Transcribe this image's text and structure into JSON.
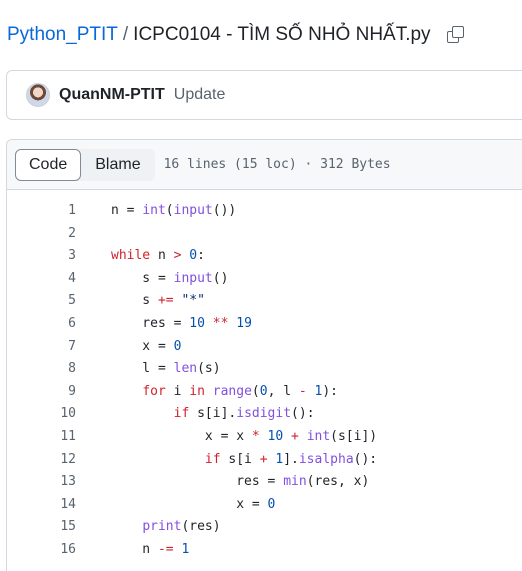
{
  "breadcrumb": {
    "repo": "Python_PTIT",
    "separator": "/",
    "file": "ICPC0104 - TÌM SỐ NHỎ NHẤT.py",
    "copy_icon": "copy-icon"
  },
  "commit": {
    "author": "QuanNM-PTIT",
    "message": "Update"
  },
  "file_header": {
    "code_tab": "Code",
    "blame_tab": "Blame",
    "meta": "16 lines (15 loc) · 312 Bytes"
  },
  "colors": {
    "link": "#0969da",
    "keyword": "#cf222e",
    "function": "#8250df",
    "number": "#0550ae",
    "string": "#0a3069"
  },
  "code": {
    "lines": [
      {
        "num": "1",
        "tokens": [
          [
            "",
            "n = "
          ],
          [
            "f",
            "int"
          ],
          [
            "",
            "("
          ],
          [
            "f",
            "input"
          ],
          [
            "",
            "())"
          ]
        ]
      },
      {
        "num": "2",
        "tokens": []
      },
      {
        "num": "3",
        "tokens": [
          [
            "k",
            "while"
          ],
          [
            "",
            " n "
          ],
          [
            "k",
            ">"
          ],
          [
            "",
            " "
          ],
          [
            "n",
            "0"
          ],
          [
            "",
            ":"
          ]
        ]
      },
      {
        "num": "4",
        "tokens": [
          [
            "",
            "    s = "
          ],
          [
            "f",
            "input"
          ],
          [
            "",
            "()"
          ]
        ]
      },
      {
        "num": "5",
        "tokens": [
          [
            "",
            "    s "
          ],
          [
            "k",
            "+="
          ],
          [
            "",
            " "
          ],
          [
            "s",
            "\"*\""
          ]
        ]
      },
      {
        "num": "6",
        "tokens": [
          [
            "",
            "    res = "
          ],
          [
            "n",
            "10"
          ],
          [
            "",
            " "
          ],
          [
            "k",
            "**"
          ],
          [
            "",
            " "
          ],
          [
            "n",
            "19"
          ]
        ]
      },
      {
        "num": "7",
        "tokens": [
          [
            "",
            "    x = "
          ],
          [
            "n",
            "0"
          ]
        ]
      },
      {
        "num": "8",
        "tokens": [
          [
            "",
            "    l = "
          ],
          [
            "f",
            "len"
          ],
          [
            "",
            "(s)"
          ]
        ]
      },
      {
        "num": "9",
        "tokens": [
          [
            "",
            "    "
          ],
          [
            "k",
            "for"
          ],
          [
            "",
            " i "
          ],
          [
            "k",
            "in"
          ],
          [
            "",
            " "
          ],
          [
            "f",
            "range"
          ],
          [
            "",
            "("
          ],
          [
            "n",
            "0"
          ],
          [
            "",
            ", l "
          ],
          [
            "k",
            "-"
          ],
          [
            "",
            " "
          ],
          [
            "n",
            "1"
          ],
          [
            "",
            "):"
          ]
        ]
      },
      {
        "num": "10",
        "tokens": [
          [
            "",
            "        "
          ],
          [
            "k",
            "if"
          ],
          [
            "",
            " s[i]."
          ],
          [
            "f",
            "isdigit"
          ],
          [
            "",
            "():"
          ]
        ]
      },
      {
        "num": "11",
        "tokens": [
          [
            "",
            "            x = x "
          ],
          [
            "k",
            "*"
          ],
          [
            "",
            " "
          ],
          [
            "n",
            "10"
          ],
          [
            "",
            " "
          ],
          [
            "k",
            "+"
          ],
          [
            "",
            " "
          ],
          [
            "f",
            "int"
          ],
          [
            "",
            "(s[i])"
          ]
        ]
      },
      {
        "num": "12",
        "tokens": [
          [
            "",
            "            "
          ],
          [
            "k",
            "if"
          ],
          [
            "",
            " s[i "
          ],
          [
            "k",
            "+"
          ],
          [
            "",
            " "
          ],
          [
            "n",
            "1"
          ],
          [
            "",
            "]."
          ],
          [
            "f",
            "isalpha"
          ],
          [
            "",
            "():"
          ]
        ]
      },
      {
        "num": "13",
        "tokens": [
          [
            "",
            "                res = "
          ],
          [
            "f",
            "min"
          ],
          [
            "",
            "(res, x)"
          ]
        ]
      },
      {
        "num": "14",
        "tokens": [
          [
            "",
            "                x = "
          ],
          [
            "n",
            "0"
          ]
        ]
      },
      {
        "num": "15",
        "tokens": [
          [
            "",
            "    "
          ],
          [
            "f",
            "print"
          ],
          [
            "",
            "(res)"
          ]
        ]
      },
      {
        "num": "16",
        "tokens": [
          [
            "",
            "    n "
          ],
          [
            "k",
            "-="
          ],
          [
            "",
            " "
          ],
          [
            "n",
            "1"
          ]
        ]
      }
    ]
  }
}
